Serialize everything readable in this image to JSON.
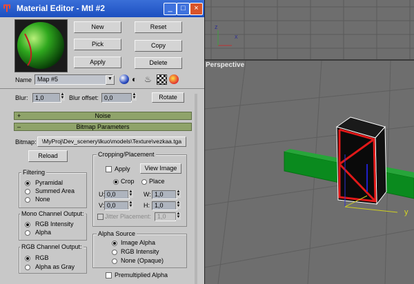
{
  "window": {
    "title": "Material Editor - Mtl #2",
    "buttons": {
      "minimize": "_",
      "maximize": "□",
      "close": "×"
    }
  },
  "viewports": {
    "top_axis": {
      "x": "x",
      "y": "y"
    },
    "perspective_label": "Perspective",
    "persp_axes": {
      "x": "x",
      "y": "y",
      "z": "z"
    }
  },
  "editor": {
    "buttons": {
      "new": "New",
      "reset": "Reset",
      "pick": "Pick",
      "copy": "Copy",
      "apply": "Apply",
      "delete": "Delete",
      "rotate": "Rotate",
      "reload": "Reload",
      "view_image": "View Image"
    },
    "name_label": "Name",
    "name_value": "Map #5",
    "blur_label": "Blur:",
    "blur_value": "1,0",
    "blur_offset_label": "Blur offset:",
    "blur_offset_value": "0,0"
  },
  "rollouts": {
    "noise": "Noise",
    "bitmap": "Bitmap Parameters"
  },
  "bitmap": {
    "label": "Bitmap:",
    "path": "\\MyProj\\Dev_scenery\\lkuo\\models\\Texture\\vezkaa.tga"
  },
  "filtering": {
    "title": "Filtering",
    "options": [
      "Pyramidal",
      "Summed Area",
      "None"
    ],
    "selected": "Pyramidal"
  },
  "mono_channel": {
    "title": "Mono Channel Output:",
    "options": [
      "RGB Intensity",
      "Alpha"
    ],
    "selected": "RGB Intensity"
  },
  "rgb_channel": {
    "title": "RGB Channel Output:",
    "options": [
      "RGB",
      "Alpha as Gray"
    ],
    "selected": "RGB"
  },
  "cropping": {
    "title": "Cropping/Placement",
    "apply_label": "Apply",
    "apply_checked": false,
    "crop_label": "Crop",
    "place_label": "Place",
    "mode_selected": "Crop",
    "u_label": "U:",
    "u_value": "0,0",
    "w_label": "W:",
    "w_value": "1,0",
    "v_label": "V:",
    "v_value": "0,0",
    "h_label": "H:",
    "h_value": "1,0",
    "jitter_label": "Jitter Placement:",
    "jitter_value": "1,0"
  },
  "alpha_source": {
    "title": "Alpha Source",
    "options": [
      "Image Alpha",
      "RGB Intensity",
      "None (Opaque)"
    ],
    "selected": "Image Alpha"
  },
  "premultiplied_alpha": {
    "label": "Premultiplied Alpha",
    "checked": false
  },
  "colors": {
    "title_bar": "#2a5fd0",
    "rollout": "#8fa36a",
    "panel": "#c8c8c8",
    "viewport": "#6e6e6e",
    "green_box": "#0a8a1e",
    "red_box": "#e01818"
  }
}
